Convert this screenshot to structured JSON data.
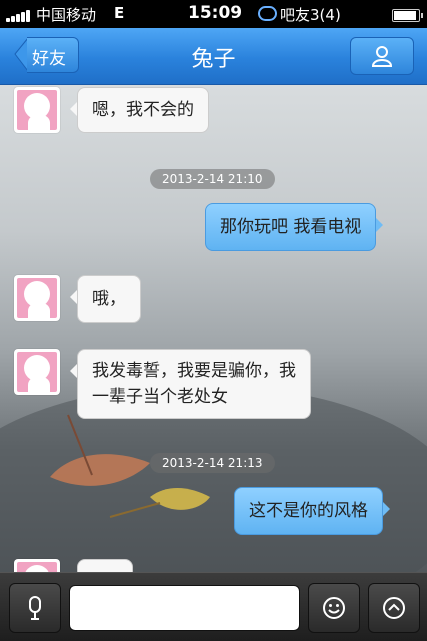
{
  "status_bar": {
    "carrier": "中国移动",
    "network": "E",
    "time": "15:09",
    "notification": "吧友3(4)"
  },
  "nav": {
    "back_label": "好友",
    "title": "兔子",
    "profile_icon": "person-icon"
  },
  "messages": [
    {
      "side": "left",
      "text": "嗯，我不会的"
    },
    {
      "side": "right",
      "text": "那你玩吧 我看电视"
    },
    {
      "side": "left",
      "text": "哦，"
    },
    {
      "side": "left",
      "lines": [
        "我发毒誓，我要是骗你，我",
        "一辈子当个老处女"
      ]
    },
    {
      "side": "right",
      "text": "这不是你的风格"
    },
    {
      "side": "left",
      "text": ""
    }
  ],
  "timestamps": [
    "2013-2-14 21:10",
    "2013-2-14 21:13"
  ],
  "input_bar": {
    "voice_icon": "microphone-icon",
    "input_value": "",
    "emoji_icon": "smiley-icon",
    "more_icon": "chevron-up-icon"
  },
  "colors": {
    "nav_blue": "#2a82dc",
    "bubble_blue": "#6fbcf5",
    "avatar_pink": "#f1a3c2"
  }
}
